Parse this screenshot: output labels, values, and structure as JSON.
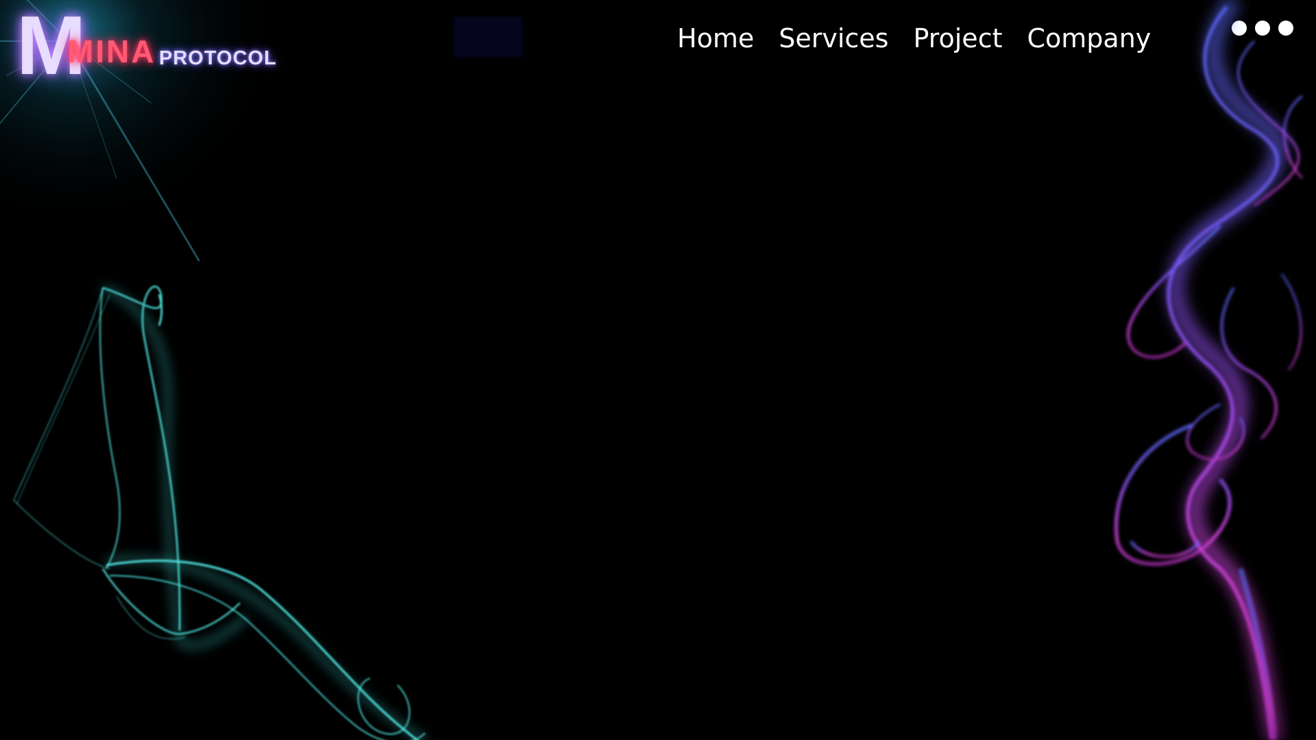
{
  "brand": {
    "mark": "M",
    "name_primary": "MINA",
    "name_secondary": "PROTOCOL"
  },
  "nav": {
    "items": [
      {
        "label": "Home"
      },
      {
        "label": "Services"
      },
      {
        "label": "Project"
      },
      {
        "label": "Company"
      }
    ]
  },
  "menu": {
    "icon": "more-dots-icon"
  },
  "colors": {
    "background": "#000000",
    "nav_text": "#ffffff",
    "smoke_left": "#3ee6e0",
    "smoke_right_top": "#5a6cff",
    "smoke_right_mid": "#a65cff",
    "smoke_right_bottom": "#e046e6"
  }
}
